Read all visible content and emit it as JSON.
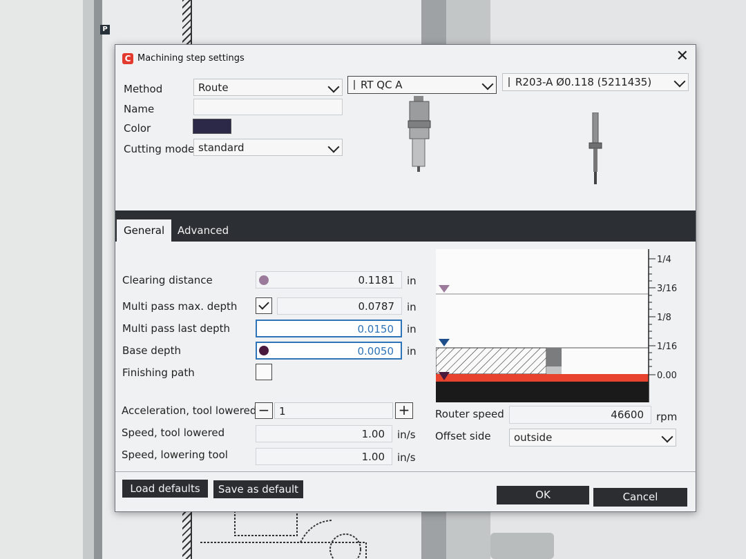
{
  "background": {
    "badge": "P"
  },
  "dialog": {
    "title": "Machining step settings",
    "app_icon": "C",
    "close_icon": "close-icon"
  },
  "form": {
    "method_label": "Method",
    "method_value": "Route",
    "name_label": "Name",
    "name_value": "",
    "color_label": "Color",
    "color_value": "#2c2848",
    "cutting_mode_label": "Cutting mode",
    "cutting_mode_value": "standard",
    "holder_value": "RT QC A",
    "tool_value": "R203-A Ø0.118 (5211435)"
  },
  "tabs": [
    {
      "label": "General",
      "active": true
    },
    {
      "label": "Advanced",
      "active": false
    }
  ],
  "general": {
    "clearing_distance_label": "Clearing distance",
    "clearing_distance_value": "0.1181",
    "clearing_distance_unit": "in",
    "multi_pass_max_label": "Multi pass max. depth",
    "multi_pass_max_checked": true,
    "multi_pass_max_value": "0.0787",
    "multi_pass_max_unit": "in",
    "multi_pass_last_label": "Multi pass last depth",
    "multi_pass_last_value": "0.0150",
    "multi_pass_last_unit": "in",
    "base_depth_label": "Base depth",
    "base_depth_value": "0.0050",
    "base_depth_unit": "in",
    "finishing_path_label": "Finishing path",
    "finishing_path_checked": false,
    "accel_label": "Acceleration, tool lowered",
    "accel_value": "1",
    "accel_minus": "−",
    "accel_plus": "+",
    "speed_lowered_label": "Speed, tool lowered",
    "speed_lowered_value": "1.00",
    "speed_lowered_unit": "in/s",
    "speed_lowering_label": "Speed, lowering tool",
    "speed_lowering_value": "1.00",
    "speed_lowering_unit": "in/s",
    "router_speed_label": "Router speed",
    "router_speed_value": "46600",
    "router_speed_unit": "rpm",
    "offset_side_label": "Offset side",
    "offset_side_value": "outside"
  },
  "depth_scale": {
    "ticks": [
      "1/4",
      "3/16",
      "1/8",
      "1/16",
      "0.00"
    ],
    "colors": {
      "material": "#1a1a1a",
      "base_layer": "#e8432e",
      "marker_top": "#1f4e8c",
      "marker_clear": "#9b7a9b"
    }
  },
  "footer": {
    "load_defaults": "Load defaults",
    "save_default": "Save as default",
    "ok": "OK",
    "cancel": "Cancel"
  }
}
